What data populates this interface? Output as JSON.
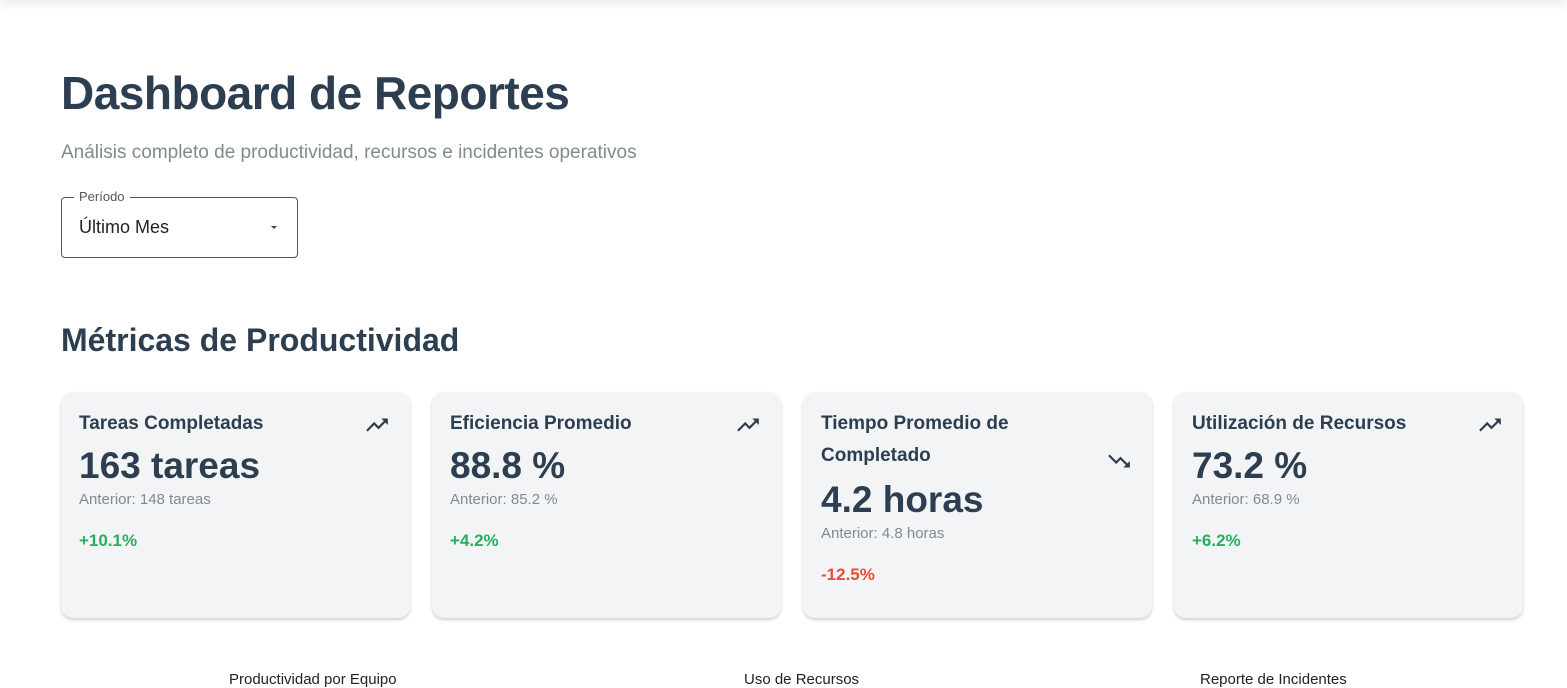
{
  "header": {
    "title": "Dashboard de Reportes",
    "subtitle": "Análisis completo de productividad, recursos e incidentes operativos"
  },
  "period": {
    "label": "Período",
    "value": "Último Mes"
  },
  "metrics_section": {
    "title": "Métricas de Productividad",
    "cards": [
      {
        "title": "Tareas Completadas",
        "value": "163 tareas",
        "previous": "Anterior: 148 tareas",
        "change": "+10.1%",
        "trend": "trending-up-icon",
        "trend_color": "#27ae60"
      },
      {
        "title": "Eficiencia Promedio",
        "value": "88.8 %",
        "previous": "Anterior: 85.2 %",
        "change": "+4.2%",
        "trend": "trending-up-icon",
        "trend_color": "#27ae60"
      },
      {
        "title": "Tiempo Promedio de Completado",
        "value": "4.2 horas",
        "previous": "Anterior: 4.8 horas",
        "change": "-12.5%",
        "trend": "trending-down-icon",
        "trend_color": "#e74c3c"
      },
      {
        "title": "Utilización de Recursos",
        "value": "73.2 %",
        "previous": "Anterior: 68.9 %",
        "change": "+6.2%",
        "trend": "trending-up-icon",
        "trend_color": "#27ae60"
      }
    ]
  },
  "charts": {
    "productivity_title": "Productividad por Equipo",
    "resources_title": "Uso de Recursos",
    "incidents_title": "Reporte de Incidentes"
  },
  "colors": {
    "heading": "#2c3e50",
    "muted": "#7f8c8d",
    "positive": "#27ae60",
    "negative": "#e74c3c",
    "card_bg": "#f3f4f6"
  }
}
